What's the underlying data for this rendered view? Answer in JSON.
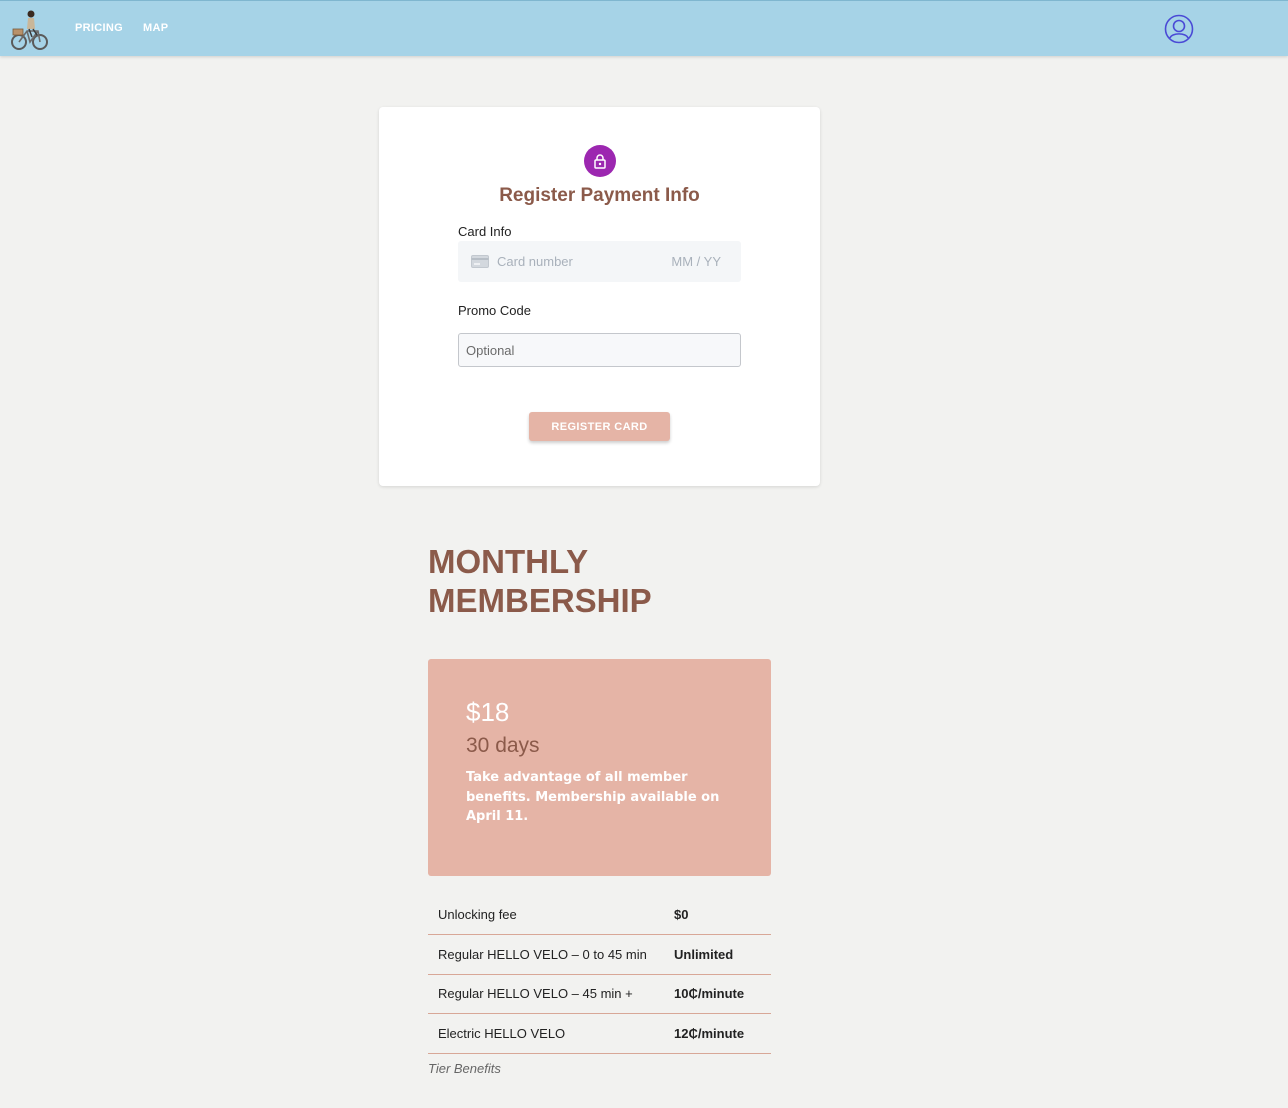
{
  "nav": {
    "logo": "bike-rider-logo",
    "links": [
      "PRICING",
      "MAP"
    ],
    "user_icon": "user-account-icon"
  },
  "payment_card": {
    "icon": "lock-icon",
    "title": "Register Payment Info",
    "card_info_label": "Card Info",
    "card_number_placeholder": "Card number",
    "card_expiry_placeholder": "MM / YY",
    "promo_label": "Promo Code",
    "promo_placeholder": "Optional",
    "promo_value": "",
    "register_button": "REGISTER CARD"
  },
  "membership": {
    "title": "MONTHLY MEMBERSHIP",
    "price": "$18",
    "duration": "30 days",
    "description": "Take advantage of all member benefits. Membership available on April 11.",
    "benefits": [
      {
        "name": "Unlocking fee",
        "value": "$0"
      },
      {
        "name": "Regular HELLO VELO – 0 to 45 min",
        "value": "Unlimited"
      },
      {
        "name": "Regular HELLO VELO – 45 min +",
        "value": "10₵/minute"
      },
      {
        "name": "Electric HELLO VELO",
        "value": "12₵/minute"
      }
    ],
    "caption": "Tier Benefits"
  },
  "colors": {
    "topbar": "#a6d3e7",
    "accent": "#e5b4a6",
    "title_brown": "#8b5a4a",
    "lock_purple": "#9c27b0",
    "background": "#f2f2f0"
  }
}
